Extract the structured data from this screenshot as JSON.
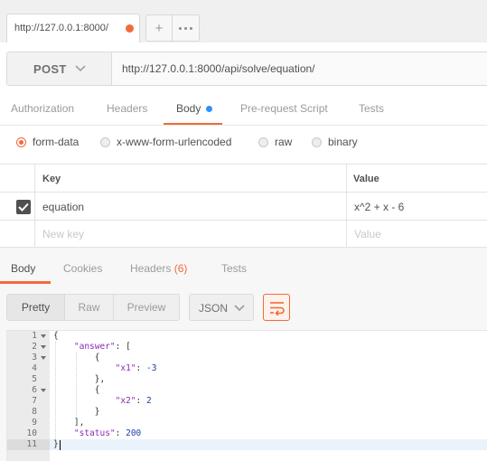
{
  "tabs": {
    "request_tab_label": "http://127.0.0.1:8000/",
    "add_label": "+",
    "dot_color": "#f26b3a"
  },
  "request": {
    "method": "POST",
    "url": "http://127.0.0.1:8000/api/solve/equation/"
  },
  "request_tabs": [
    {
      "label": "Authorization"
    },
    {
      "label": "Headers"
    },
    {
      "label": "Body"
    },
    {
      "label": "Pre-request Script"
    },
    {
      "label": "Tests"
    }
  ],
  "body_types": [
    {
      "label": "form-data",
      "selected": true
    },
    {
      "label": "x-www-form-urlencoded",
      "selected": false
    },
    {
      "label": "raw",
      "selected": false
    },
    {
      "label": "binary",
      "selected": false
    }
  ],
  "params": {
    "key_header": "Key",
    "value_header": "Value",
    "rows": [
      {
        "key": "equation",
        "value": "x^2 + x - 6",
        "checked": true
      }
    ],
    "new_key_placeholder": "New key",
    "new_value_placeholder": "Value"
  },
  "response_tabs": {
    "body": "Body",
    "cookies": "Cookies",
    "headers": "Headers",
    "headers_count": "(6)",
    "tests": "Tests"
  },
  "view_modes": [
    "Pretty",
    "Raw",
    "Preview"
  ],
  "format": "JSON",
  "code": {
    "line_numbers": [
      "1",
      "2",
      "3",
      "4",
      "5",
      "6",
      "7",
      "8",
      "9",
      "10",
      "11"
    ],
    "lines": [
      "{",
      "    \"answer\": [",
      "        {",
      "            \"x1\": -3",
      "        },",
      "        {",
      "            \"x2\": 2",
      "        }",
      "    ],",
      "    \"status\": 200",
      "}"
    ]
  },
  "colors": {
    "accent": "#f26b3a",
    "body_indicator": "#2f8fff"
  }
}
